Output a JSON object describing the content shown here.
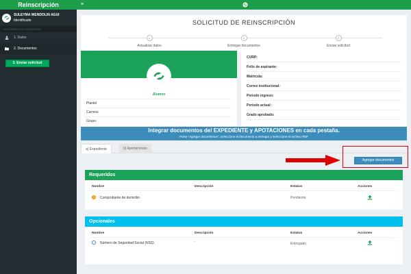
{
  "sidebar": {
    "brand": "Reinscripción",
    "user_name": "SULEYMA WENDOLIN AGUI",
    "user_status": "Identificado",
    "section_header": "INFORMACION REQUERIDA",
    "items": [
      {
        "label": "1. Datos",
        "icon": "user-icon"
      },
      {
        "label": "2. Documentos",
        "icon": "folder-icon"
      }
    ],
    "send_button": "3. Enviar solicitud"
  },
  "topbar": {
    "menu_icon": "≡"
  },
  "wizard": {
    "title": "SOLICITUD DE REINSCRIPCIÓN",
    "steps": [
      {
        "number": "1",
        "label": "Actualizar datos"
      },
      {
        "number": "2",
        "label": "Entregar documentos"
      },
      {
        "number": "3",
        "label": "Enviar solicitud"
      }
    ]
  },
  "profile": {
    "role": "Alumno",
    "fields": [
      "Plantel",
      "Carrera:",
      "Grupo:"
    ]
  },
  "details": {
    "fields": [
      "CURP:",
      "Folio de aspirante:",
      "Matrícula:",
      "Correo institucional:",
      "Periodo ingreso:",
      "Periodo actual:",
      "Grado aprobado:"
    ]
  },
  "banner": {
    "title": "Integrar documentos del EXPEDIENTE y APOTACIONES en cada pestaña.",
    "subtitle": "Pulse \"Agregar documentos\", seleccione el documento a entregar y seleccione el archivo PDF"
  },
  "tabs": [
    {
      "label": "a) Expediente",
      "active": true
    },
    {
      "label": "b) Aportaciones",
      "active": false
    }
  ],
  "add_button": "Agregar documentos",
  "required": {
    "title": "Requeridos",
    "headers": [
      "Nombre",
      "Descripción",
      "Estatus",
      "Acciones"
    ],
    "rows": [
      {
        "name": "Comprobante de domicilio",
        "description": "",
        "status": "Pendiente"
      }
    ]
  },
  "optional": {
    "title": "Opcionales",
    "headers": [
      "Nombre",
      "Descripción",
      "Estatus",
      "Acciones"
    ],
    "rows": [
      {
        "name": "Número de Seguridad Social (NSS)",
        "description": "-",
        "status": "Entregado"
      }
    ]
  },
  "colors": {
    "brand_green": "#1e9e4a",
    "sidebar_dark": "#222d32",
    "primary_blue": "#3c8dbc",
    "info_cyan": "#00c0ef",
    "warning_orange": "#f39c12",
    "highlight_red": "#dd0000"
  }
}
